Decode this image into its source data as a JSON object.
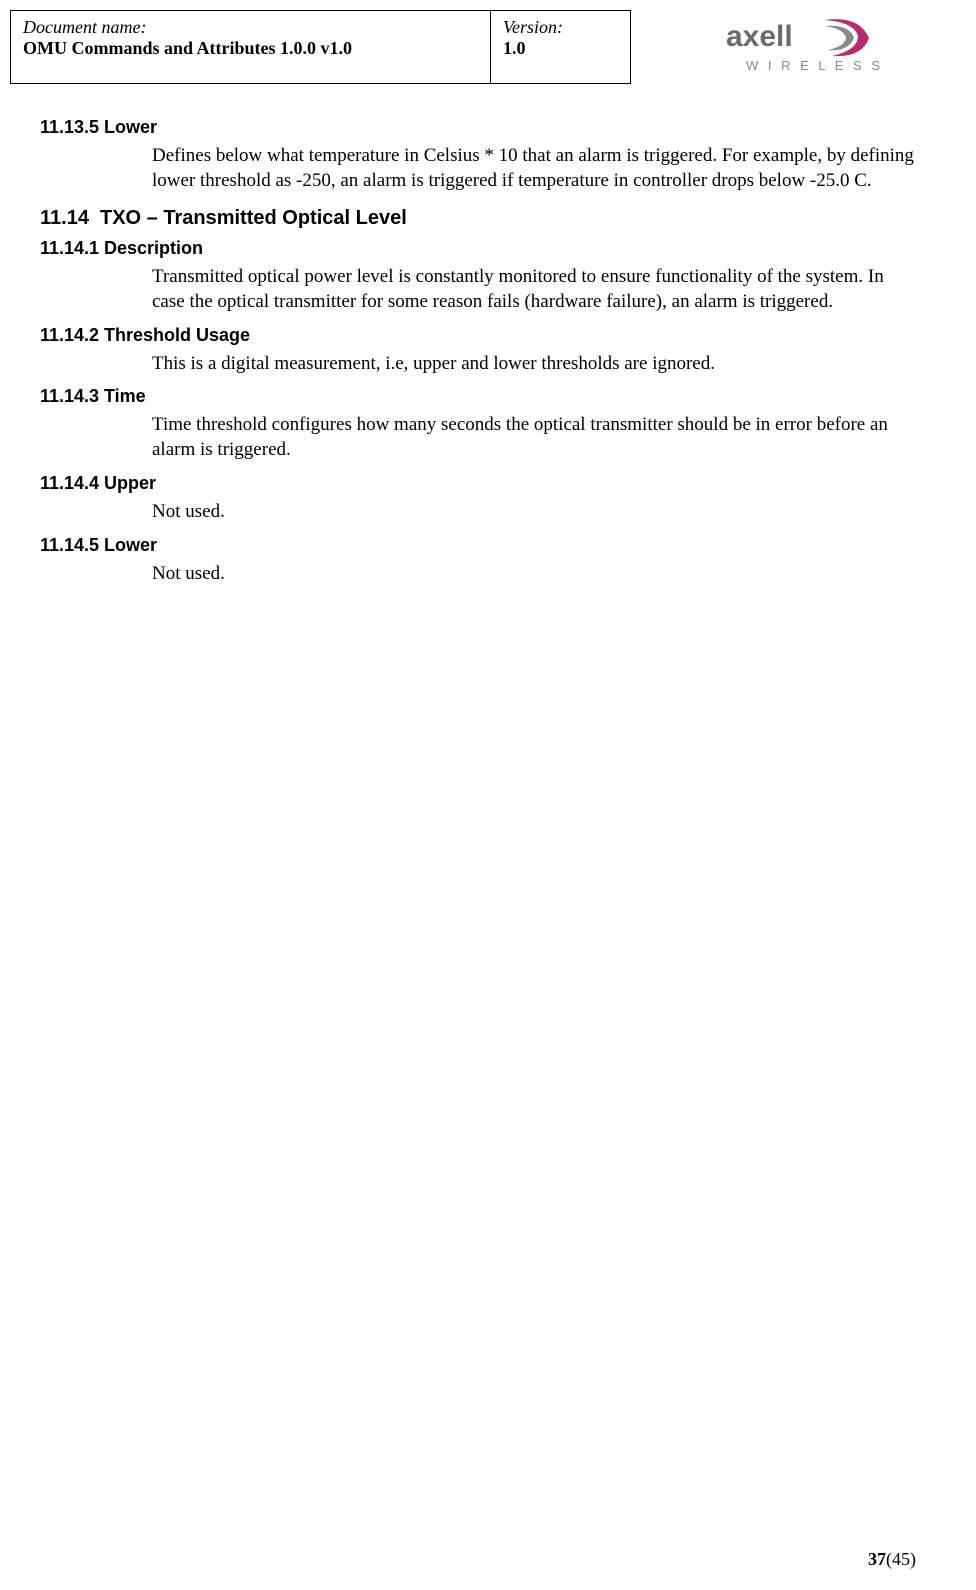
{
  "header": {
    "docname_label": "Document name:",
    "docname_value": "OMU Commands and Attributes 1.0.0 v1.0",
    "version_label": "Version:",
    "version_value": "1.0",
    "logo_top": "axell",
    "logo_bottom": "W I R E L E S S"
  },
  "sections": {
    "s11_13_5": {
      "num": "11.13.5",
      "title": "Lower",
      "body": "Defines below what temperature in Celsius * 10 that an alarm is triggered. For example, by defining lower threshold as -250, an alarm is triggered if temperature in controller drops below -25.0 C."
    },
    "s11_14": {
      "num": "11.14",
      "title": "TXO – Transmitted Optical Level"
    },
    "s11_14_1": {
      "num": "11.14.1",
      "title": "Description",
      "body": "Transmitted optical power level is constantly monitored to ensure functionality of the system. In case the optical transmitter for some reason fails (hardware failure), an alarm is triggered."
    },
    "s11_14_2": {
      "num": "11.14.2",
      "title": "Threshold Usage",
      "body": "This is a digital measurement, i.e, upper and lower thresholds are ignored."
    },
    "s11_14_3": {
      "num": "11.14.3",
      "title": "Time",
      "body": "Time threshold configures how many seconds the optical transmitter should be in error before an alarm is triggered."
    },
    "s11_14_4": {
      "num": "11.14.4",
      "title": "Upper",
      "body": "Not used."
    },
    "s11_14_5": {
      "num": "11.14.5",
      "title": "Lower",
      "body": "Not used."
    }
  },
  "footer": {
    "page": "37",
    "total": "(45)"
  }
}
